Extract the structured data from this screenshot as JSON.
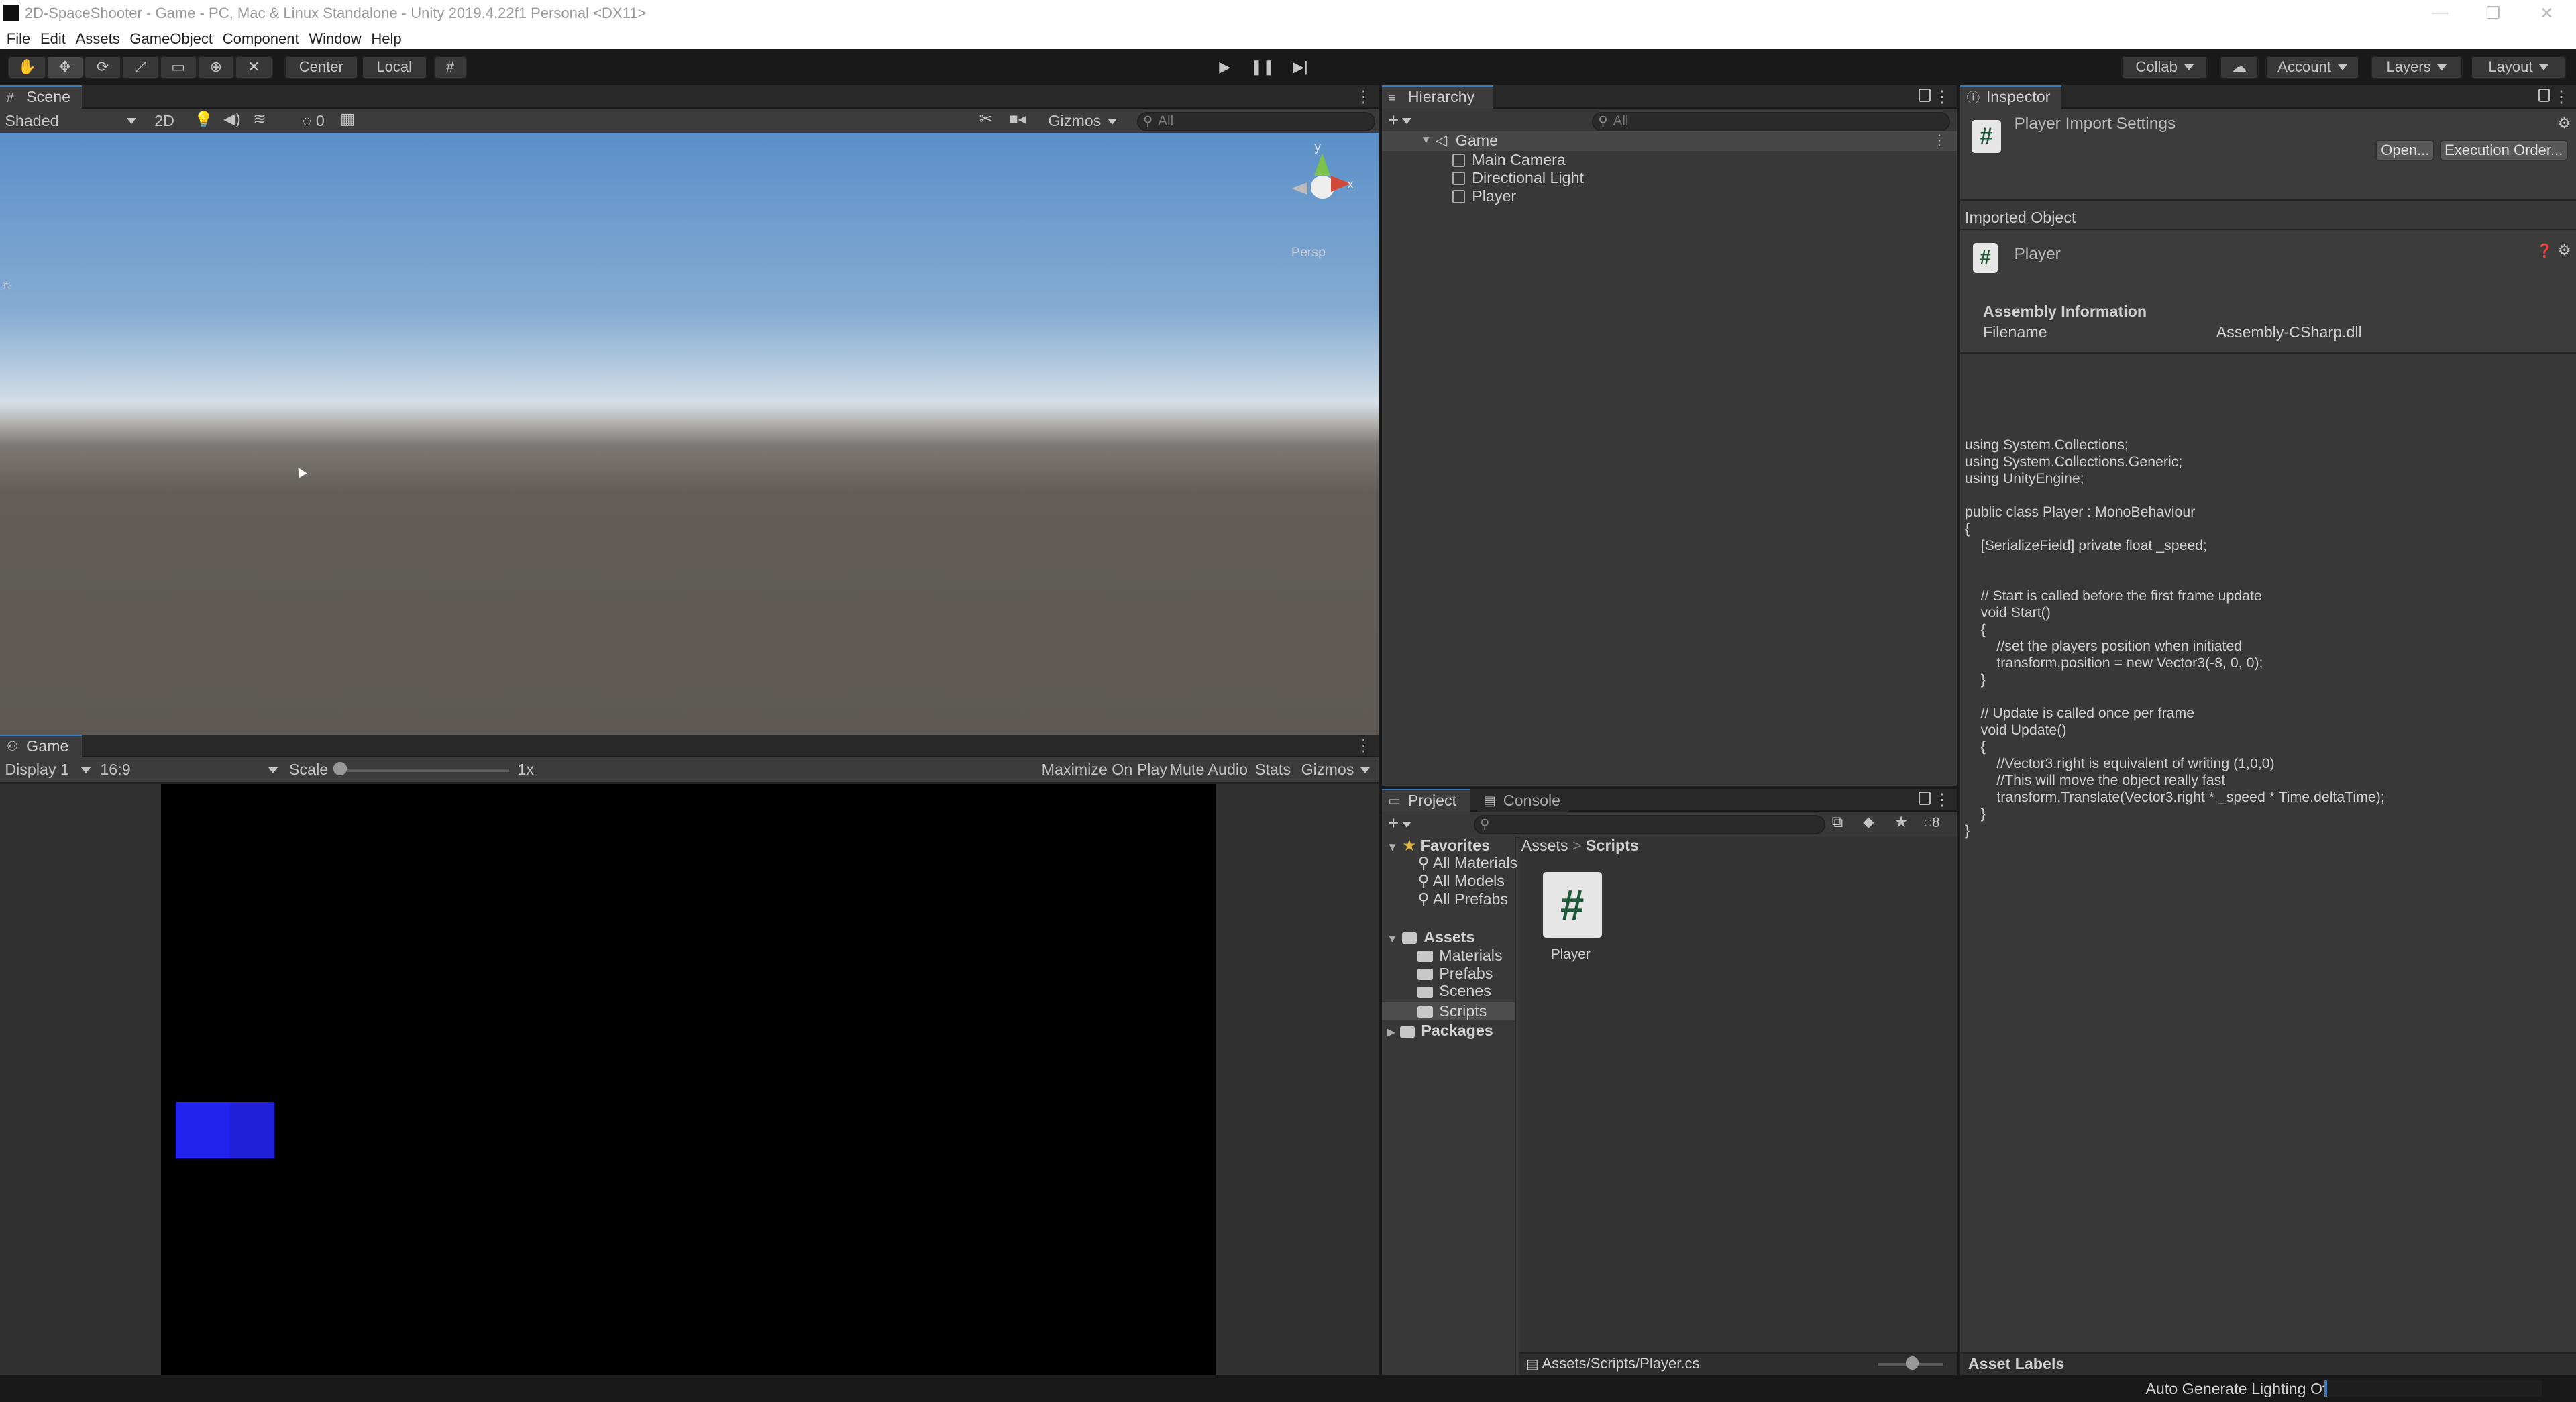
{
  "window": {
    "title": "2D-SpaceShooter - Game - PC, Mac & Linux Standalone - Unity 2019.4.22f1 Personal <DX11>"
  },
  "menu": [
    "File",
    "Edit",
    "Assets",
    "GameObject",
    "Component",
    "Window",
    "Help"
  ],
  "toolbar": {
    "pivot": "Center",
    "space": "Local",
    "collab": "Collab",
    "account": "Account",
    "layers": "Layers",
    "layout": "Layout"
  },
  "scene": {
    "tab": "Scene",
    "shading": "Shaded",
    "mode_2d": "2D",
    "hidden_count": "0",
    "gizmos": "Gizmos",
    "search_placeholder": "All",
    "gizmo_axes": {
      "y": "y",
      "x": "x"
    },
    "persp_label": "Persp"
  },
  "game": {
    "tab": "Game",
    "display": "Display 1",
    "aspect": "16:9",
    "scale_label": "Scale",
    "scale_value": "1x",
    "maximize": "Maximize On Play",
    "mute": "Mute Audio",
    "stats": "Stats",
    "gizmos": "Gizmos",
    "cube_color": "#2424ee"
  },
  "hierarchy": {
    "tab": "Hierarchy",
    "search_placeholder": "All",
    "scene_name": "Game",
    "items": [
      "Main Camera",
      "Directional Light",
      "Player"
    ]
  },
  "inspector": {
    "tab": "Inspector",
    "header": "Player Import Settings",
    "open_button": "Open...",
    "execution_order_button": "Execution Order...",
    "imported_object": "Imported Object",
    "object_name": "Player",
    "assembly_header": "Assembly Information",
    "filename_label": "Filename",
    "filename_value": "Assembly-CSharp.dll",
    "code": "using System.Collections;\nusing System.Collections.Generic;\nusing UnityEngine;\n\npublic class Player : MonoBehaviour\n{\n    [SerializeField] private float _speed;\n\n\n    // Start is called before the first frame update\n    void Start()\n    {\n        //set the players position when initiated\n        transform.position = new Vector3(-8, 0, 0);\n    }\n\n    // Update is called once per frame\n    void Update()\n    {\n        //Vector3.right is equivalent of writing (1,0,0)\n        //This will move the object really fast\n        transform.Translate(Vector3.right * _speed * Time.deltaTime);\n    }\n}",
    "asset_labels": "Asset Labels"
  },
  "project": {
    "tab_project": "Project",
    "tab_console": "Console",
    "hidden_count": "8",
    "favorites": "Favorites",
    "favorite_items": [
      "All Materials",
      "All Models",
      "All Prefabs"
    ],
    "assets": "Assets",
    "folders": [
      "Materials",
      "Prefabs",
      "Scenes",
      "Scripts"
    ],
    "packages": "Packages",
    "breadcrumb": [
      "Assets",
      "Scripts"
    ],
    "file_name": "Player",
    "path": "Assets/Scripts/Player.cs"
  },
  "statusbar": {
    "lighting": "Auto Generate Lighting Off"
  }
}
